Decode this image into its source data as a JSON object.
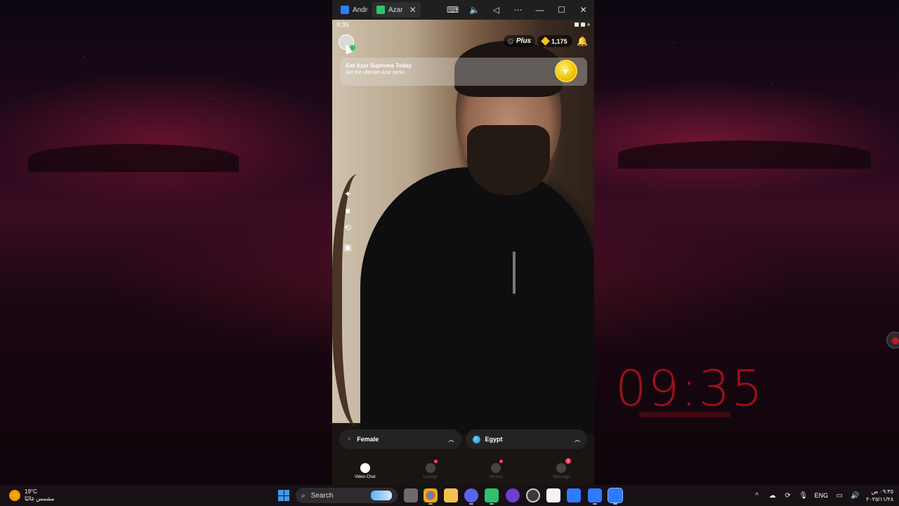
{
  "desktop": {
    "clock": "09:35"
  },
  "window": {
    "tabs": [
      {
        "label": "Android",
        "icon": "android-emulator-icon",
        "active": false
      },
      {
        "label": "Azar",
        "icon": "azar-icon",
        "active": true
      }
    ],
    "toolbar": [
      "keyboard-icon",
      "volume-icon",
      "back-icon",
      "more-icon",
      "minimize-icon",
      "maximize-icon",
      "close-icon"
    ]
  },
  "phone": {
    "status_time": "9:35",
    "plus_label": "Plus",
    "gems": "1,175",
    "promo": {
      "title": "Get Azar Supreme Today",
      "subtitle": "Get the ultimate Azar perks."
    },
    "filters": {
      "gender": "Female",
      "country": "Egypt"
    },
    "nav": [
      {
        "label": "Video Chat",
        "active": true
      },
      {
        "label": "Lounge",
        "active": false
      },
      {
        "label": "History",
        "active": false
      },
      {
        "label": "Message",
        "active": false,
        "badge": "1"
      }
    ]
  },
  "taskbar": {
    "weather_temp": "19°C",
    "weather_desc": "مشمس غالبًا",
    "search_placeholder": "Search",
    "language": "ENG",
    "time": "٠٩:٣٥ ص",
    "date": "٢٠٢٥/١١/٢٨"
  },
  "colors": {
    "accent_pink": "#ff3d6b",
    "clock_red": "#b3121e",
    "gem_gold": "#f5c518"
  }
}
